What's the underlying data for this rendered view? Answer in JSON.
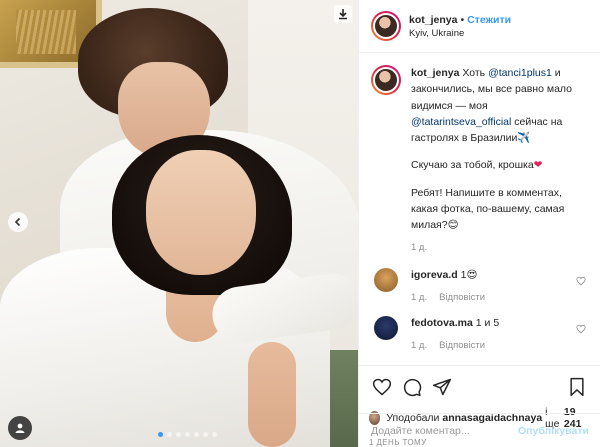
{
  "post": {
    "author": "kot_jenya",
    "separator": "•",
    "follow_label": "Стежити",
    "location": "Kyiv, Ukraine"
  },
  "caption": {
    "author": "kot_jenya",
    "text_1": "Хоть",
    "mention_1": "@tanci1plus1",
    "text_2": "и закончились, мы все равно мало видимся — моя",
    "mention_2": "@tatarintseva_official",
    "text_3": "сейчас на гастролях в Бразилии",
    "text_3_emoji": "✈️",
    "para_2": "Скучаю за тобой, крошка",
    "para_2_emoji": "❤",
    "para_3": "Ребят! Напишите в комментах, какая фотка, по-вашему, самая милая?",
    "para_3_emoji": "😊",
    "time": "1 д."
  },
  "comments": [
    {
      "username": "igoreva.d",
      "text": "1😍",
      "time": "1 д.",
      "reply_label": "Відповісти"
    },
    {
      "username": "fedotova.ma",
      "text": "1 и 5",
      "time": "1 д.",
      "reply_label": "Відповісти"
    }
  ],
  "likes": {
    "prefix": "Уподобали",
    "user": "annasagaidachnaya",
    "middle": "і ще",
    "count": "19 241"
  },
  "posted_ago": "1 ДЕНЬ ТОМУ",
  "comment_box": {
    "placeholder": "Додайте коментар...",
    "publish_label": "Опублікувати"
  },
  "carousel": {
    "total": 7,
    "active_index": 0
  },
  "colors": {
    "accent": "#3897f0",
    "heart": "#e0245e",
    "muted": "#8e8e8e"
  }
}
